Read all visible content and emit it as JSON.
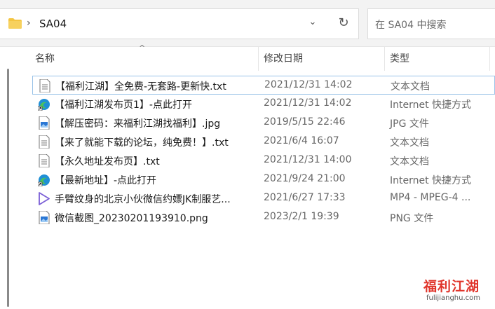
{
  "address": {
    "crumb": "SA04"
  },
  "search": {
    "placeholder": "在 SA04 中搜索"
  },
  "columns": {
    "name": "名称",
    "date": "修改日期",
    "type": "类型"
  },
  "files": [
    {
      "name": "【福利江湖】全免费-无套路-更新快.txt",
      "date": "2021/12/31 14:02",
      "type": "文本文档",
      "icon": "text-file-icon"
    },
    {
      "name": "【福利江湖发布页1】-点此打开",
      "date": "2021/12/31 14:02",
      "type": "Internet 快捷方式",
      "icon": "edge-shortcut-icon"
    },
    {
      "name": "【解压密码：来福利江湖找福利】.jpg",
      "date": "2019/5/15 22:46",
      "type": "JPG 文件",
      "icon": "image-file-icon"
    },
    {
      "name": "【来了就能下载的论坛，纯免费！】.txt",
      "date": "2021/6/4 16:07",
      "type": "文本文档",
      "icon": "text-file-icon"
    },
    {
      "name": "【永久地址发布页】.txt",
      "date": "2021/12/31 14:00",
      "type": "文本文档",
      "icon": "text-file-icon"
    },
    {
      "name": "【最新地址】-点此打开",
      "date": "2021/9/24 21:00",
      "type": "Internet 快捷方式",
      "icon": "edge-shortcut-icon"
    },
    {
      "name": "手臂纹身的北京小伙微信约嫖JK制服艺...",
      "date": "2021/6/27 17:33",
      "type": "MP4 - MPEG-4 ...",
      "icon": "video-file-icon"
    },
    {
      "name": "微信截图_20230201193910.png",
      "date": "2023/2/1 19:39",
      "type": "PNG 文件",
      "icon": "image-file-icon"
    }
  ],
  "watermark": {
    "main": "福利江湖",
    "sub": "fulijianghu.com"
  },
  "colors": {
    "selection_border": "#99c2e8",
    "folder": "#f4c542",
    "edge": "#1f8fd6",
    "watermark": "#e0342a"
  }
}
